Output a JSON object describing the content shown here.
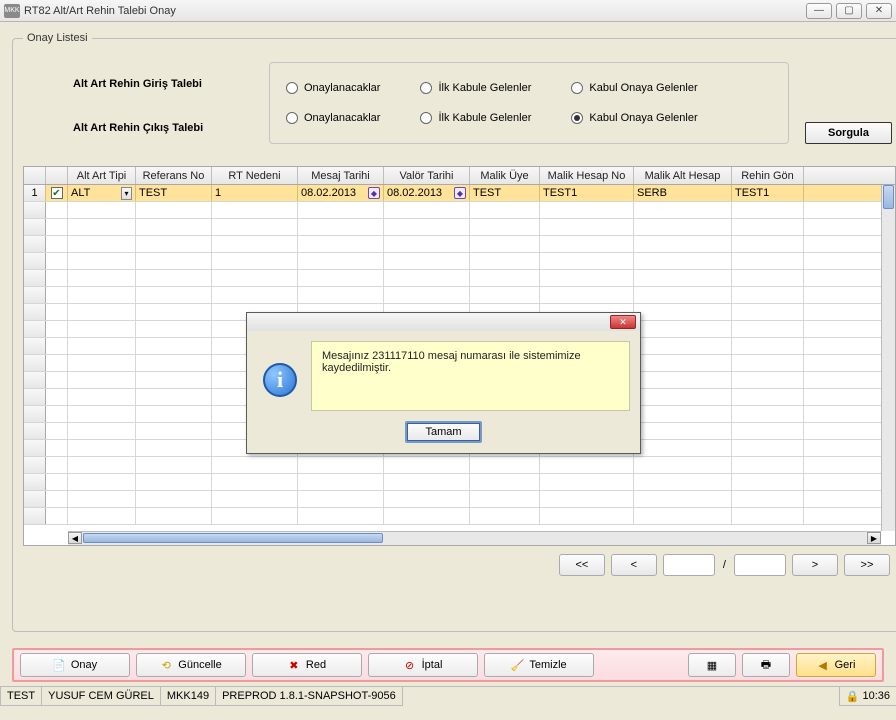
{
  "window": {
    "title": "RT82 Alt/Art Rehin Talebi Onay",
    "app_icon_text": "MKK"
  },
  "fieldset": {
    "legend": "Onay Listesi"
  },
  "filters": {
    "row1_label": "Alt Art Rehin Giriş Talebi",
    "row2_label": "Alt Art Rehin Çıkış Talebi",
    "opt1": "Onaylanacaklar",
    "opt2": "İlk Kabule Gelenler",
    "opt3": "Kabul Onaya Gelenler",
    "sorgula": "Sorgula"
  },
  "table": {
    "headers": {
      "alt": "Alt Art Tipi",
      "ref": "Referans No",
      "rt": "RT Nedeni",
      "mt": "Mesaj Tarihi",
      "vt": "Valör Tarihi",
      "mu": "Malik Üye",
      "mh": "Malik Hesap No",
      "ma": "Malik Alt Hesap",
      "rg": "Rehin Gön"
    },
    "row1": {
      "num": "1",
      "alt": "ALT",
      "ref": "TEST",
      "rt": "1",
      "mt": "08.02.2013",
      "vt": "08.02.2013",
      "mu": "TEST",
      "mh": "TEST1",
      "ma": "SERB",
      "rg": "TEST1"
    }
  },
  "pager": {
    "first": "<<",
    "prev": "<",
    "sep": "/",
    "next": ">",
    "last": ">>"
  },
  "toolbar": {
    "onay": "Onay",
    "guncelle": "Güncelle",
    "red": "Red",
    "iptal": "İptal",
    "temizle": "Temizle",
    "geri": "Geri"
  },
  "status": {
    "c1": "TEST",
    "c2": "YUSUF CEM GÜREL",
    "c3": "MKK149",
    "c4": "PREPROD 1.8.1-SNAPSHOT-9056",
    "time": "10:36"
  },
  "dialog": {
    "message": "Mesajınız 231117110 mesaj numarası ile sistemimize kaydedilmiştir.",
    "ok": "Tamam"
  }
}
